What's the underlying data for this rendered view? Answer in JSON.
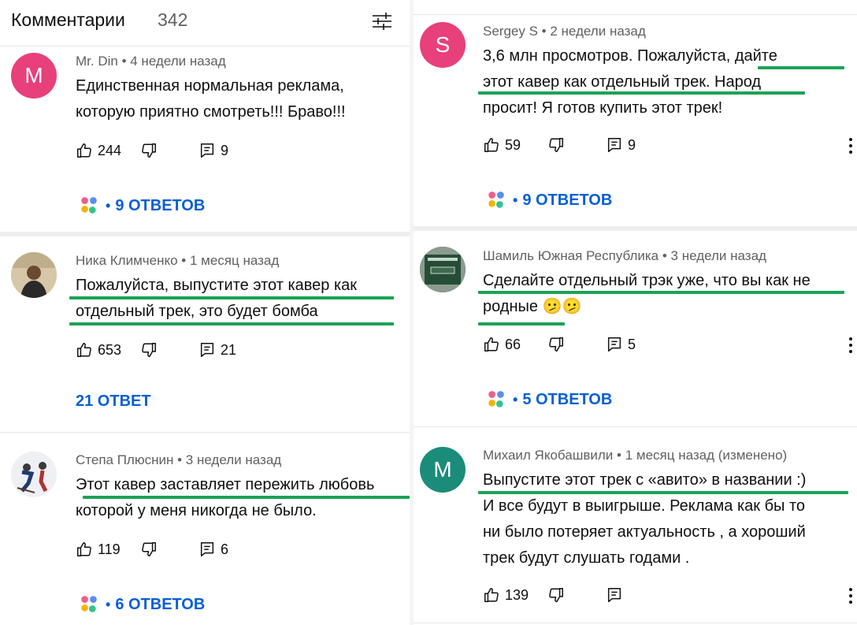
{
  "header": {
    "title": "Комментарии",
    "count": "342"
  },
  "colors": {
    "underline": "#1aa356",
    "link": "#065fd4",
    "avatar_m": "#e8407a",
    "avatar_s": "#e8407a",
    "avatar_m2": "#1b8c7a"
  },
  "left": [
    {
      "author": "Mr. Din",
      "time": "4 недели назад",
      "avatar_letter": "M",
      "lines": [
        "Единственная нормальная реклама,",
        "которую приятно смотреть!!! Браво!!!"
      ],
      "likes": "244",
      "reply_count": "9",
      "replies_label": "9 ОТВЕТОВ"
    },
    {
      "author": "Ника Климченко",
      "time": "1 месяц назад",
      "avatar_letter": "",
      "lines": [
        "Пожалуйста, выпустите этот кавер как",
        "отдельный трек, это будет бомба"
      ],
      "likes": "653",
      "reply_count": "21",
      "replies_label": "21 ОТВЕТ"
    },
    {
      "author": "Степа Плюснин",
      "time": "3 недели назад",
      "avatar_letter": "",
      "lines": [
        "Этот кавер заставляет пережить любовь",
        "которой у меня никогда не было."
      ],
      "likes": "119",
      "reply_count": "6",
      "replies_label": "6 ОТВЕТОВ"
    }
  ],
  "right": [
    {
      "author": "Sergey S",
      "time": "2 недели назад",
      "avatar_letter": "S",
      "lines": [
        "3,6 млн просмотров. Пожалуйста,  дайте",
        "этот кавер как отдельный трек. Народ",
        "просит!  Я готов купить этот трек!"
      ],
      "likes": "59",
      "reply_count": "9",
      "replies_label": "9 ОТВЕТОВ"
    },
    {
      "author": "Шамиль Южная Республика",
      "time": "3 недели назад",
      "avatar_letter": "",
      "lines": [
        "Сделайте отдельный трэк уже, что вы как не",
        "родные 🫤🫤"
      ],
      "likes": "66",
      "reply_count": "5",
      "replies_label": "5 ОТВЕТОВ"
    },
    {
      "author": "Михаил Якобашвили",
      "time": "1 месяц назад (изменено)",
      "avatar_letter": "M",
      "lines": [
        "Выпустите этот трек с «авито» в названии :)",
        "И все будут в выигрыше. Реклама как бы то",
        "ни было потеряет актуальность , а хороший",
        "трек будут слушать годами ."
      ],
      "likes": "139",
      "reply_count": "",
      "replies_label": ""
    }
  ]
}
